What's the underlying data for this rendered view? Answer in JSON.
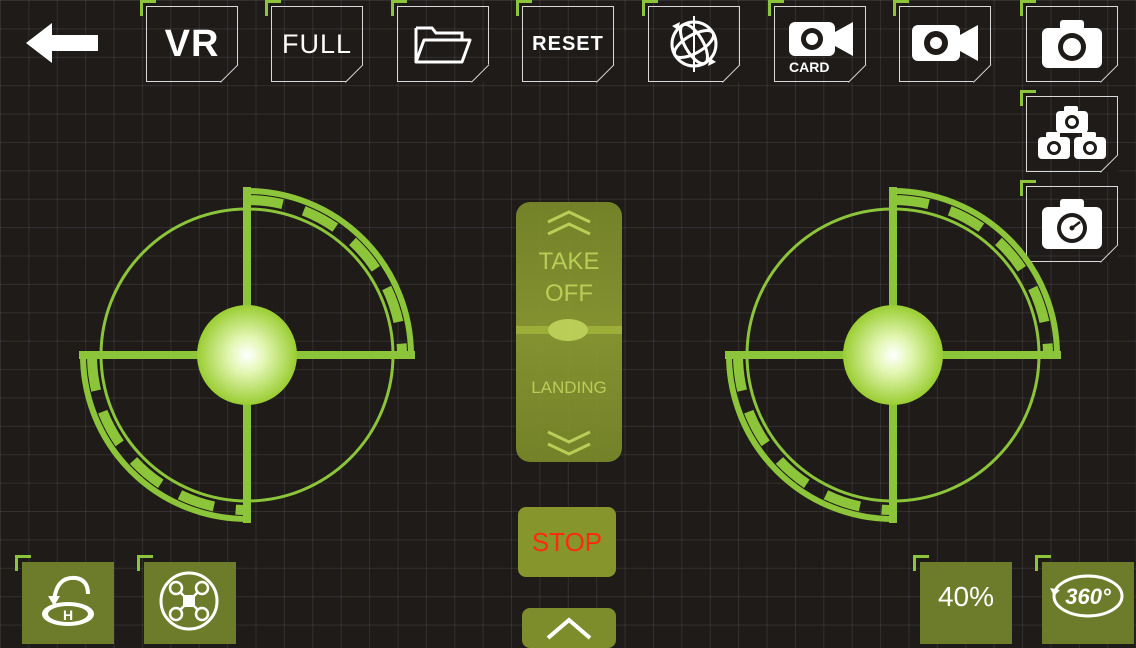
{
  "toolbar": {
    "vr_label": "VR",
    "full_label": "FULL",
    "reset_label": "RESET",
    "card_label": "CARD"
  },
  "throttle": {
    "take_off_line1": "TAKE",
    "take_off_line2": "OFF",
    "landing_label": "LANDING"
  },
  "stop_label": "STOP",
  "speed_label": "40%",
  "rotate_label": "360°",
  "colors": {
    "accent_green": "#8cc43a",
    "olive": "#6d7c2a",
    "stop_red": "#ff2a10",
    "background": "#1e1b19"
  },
  "icons": {
    "back": "back-arrow-icon",
    "folder": "folder-icon",
    "gyro": "gyro-calibrate-icon",
    "record_card": "video-camera-card-icon",
    "record": "video-camera-icon",
    "photo": "camera-icon",
    "burst": "burst-camera-icon",
    "timer": "timer-camera-icon",
    "home": "return-home-icon",
    "drone": "drone-icon"
  }
}
